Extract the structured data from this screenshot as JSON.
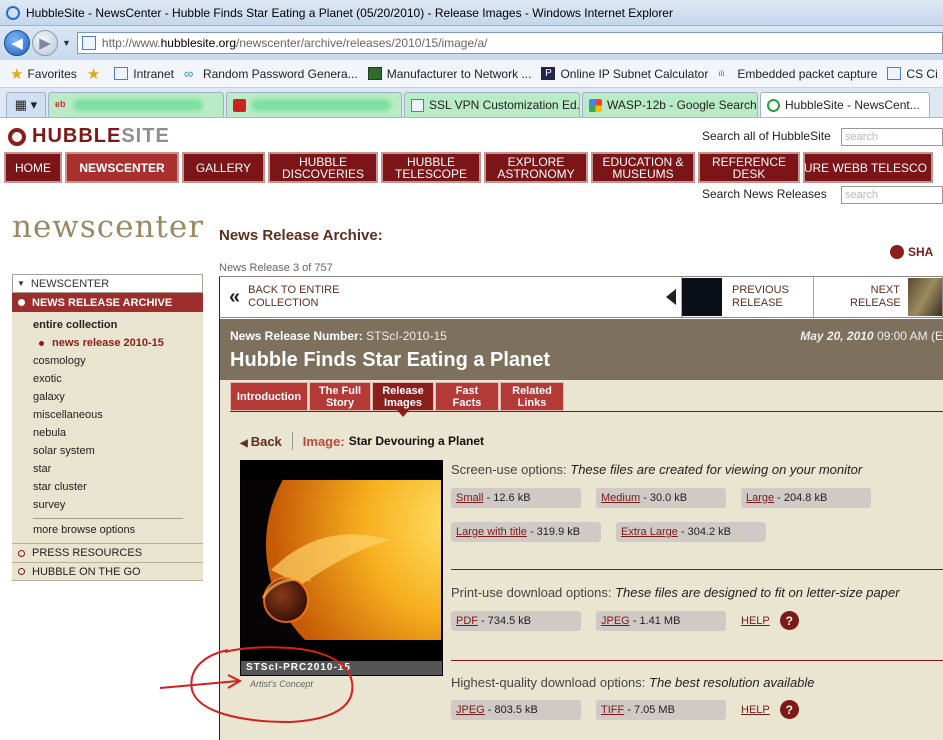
{
  "window": {
    "title": "HubbleSite - NewsCenter - Hubble Finds Star Eating a Planet (05/20/2010) - Release Images - Windows Internet Explorer"
  },
  "address": {
    "url_prefix": "http://www.",
    "url_domain": "hubblesite.org",
    "url_path": "/newscenter/archive/releases/2010/15/image/a/"
  },
  "favorites": {
    "label": "Favorites",
    "items": [
      "Intranet",
      "Random Password Genera...",
      "Manufacturer to Network ...",
      "Online IP Subnet Calculator",
      "Embedded packet capture",
      "CS Ci"
    ]
  },
  "tabs": {
    "items": [
      "SSL VPN Customization Ed...",
      "WASP-12b - Google Search",
      "HubbleSite - NewsCent..."
    ]
  },
  "site": {
    "logo_a": "HUBBLE",
    "logo_b": "SITE",
    "search_all_label": "Search all of HubbleSite",
    "search_placeholder": "search",
    "search_news_label": "Search News Releases",
    "nav": [
      "HOME",
      "NEWSCENTER",
      "GALLERY",
      "HUBBLE DISCOVERIES",
      "HUBBLE TELESCOPE",
      "EXPLORE ASTRONOMY",
      "EDUCATION & MUSEUMS",
      "REFERENCE DESK",
      "THE FUTURE WEBB TELESCO"
    ],
    "wordmark": "newscenter",
    "archive_heading": "News Release Archive:",
    "share": "SHA",
    "release_count": "News Release 3 of 757"
  },
  "leftnav": {
    "head": "NEWSCENTER",
    "active": "NEWS RELEASE ARCHIVE",
    "entire": "entire collection",
    "current": "news release 2010-15",
    "items": [
      "cosmology",
      "exotic",
      "galaxy",
      "miscellaneous",
      "nebula",
      "solar system",
      "star",
      "star cluster",
      "survey"
    ],
    "more": "more browse options",
    "foot1": "PRESS RESOURCES",
    "foot2": "HUBBLE ON THE GO"
  },
  "browse": {
    "back": "BACK TO ENTIRE COLLECTION",
    "prev": "PREVIOUS RELEASE",
    "next": "NEXT RELEASE"
  },
  "release": {
    "number_label": "News Release Number:",
    "number": "STScI-2010-15",
    "date": "May 20, 2010",
    "time": "09:00 AM (E",
    "title": "Hubble Finds Star Eating a Planet",
    "tabs": [
      "Introduction",
      "The Full Story",
      "Release Images",
      "Fast Facts",
      "Related Links"
    ],
    "back": "Back",
    "image_label": "Image:",
    "image_title": "Star Devouring a Planet",
    "caption": "STScI-PRC2010-15",
    "credit": "Artist's Concept"
  },
  "screen": {
    "heading": "Screen-use options:",
    "desc": "These files are created for viewing on your monitor",
    "opts": [
      {
        "name": "Small",
        "size": "- 12.6 kB"
      },
      {
        "name": "Medium",
        "size": "- 30.0 kB"
      },
      {
        "name": "Large",
        "size": "- 204.8 kB"
      },
      {
        "name": "Large with title",
        "size": "- 319.9 kB"
      },
      {
        "name": "Extra Large",
        "size": "- 304.2 kB"
      }
    ]
  },
  "print": {
    "heading": "Print-use download options:",
    "desc": "These files are designed to fit on letter-size paper",
    "opts": [
      {
        "name": "PDF",
        "size": "- 734.5 kB"
      },
      {
        "name": "JPEG",
        "size": "- 1.41 MB"
      }
    ],
    "help": "HELP"
  },
  "hq": {
    "heading": "Highest-quality download options:",
    "desc": "The best resolution available",
    "opts": [
      {
        "name": "JPEG",
        "size": "- 803.5 kB"
      },
      {
        "name": "TIFF",
        "size": "- 7.05 MB"
      }
    ],
    "help": "HELP"
  },
  "colors": {
    "brand": "#7d1a18",
    "annotation": "#d42020"
  }
}
